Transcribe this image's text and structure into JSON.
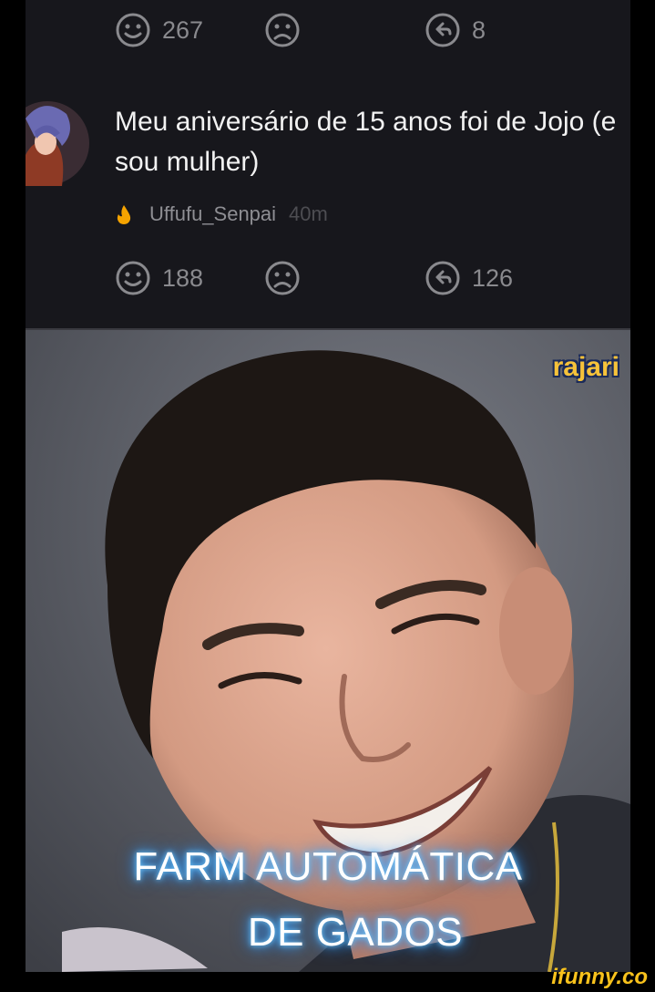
{
  "top_actions": {
    "smile_count": "267",
    "reply_count": "8"
  },
  "comment": {
    "text": "Meu aniversário de 15 anos foi de Jojo (e sou mulher)",
    "username": "Uffufu_Senpai",
    "time": "40m",
    "badge_icon": "fire-icon",
    "smile_count": "188",
    "reply_count": "126"
  },
  "meme": {
    "watermark": "rajari",
    "caption_line1": "FARM AUTOMÁTICA",
    "caption_line2": "DE GADOS"
  },
  "footer": {
    "logo": "ifunny.co"
  },
  "colors": {
    "background": "#17171c",
    "muted_text": "#8a8a8e",
    "accent": "#f8c21c",
    "fire": "#f5a300"
  }
}
